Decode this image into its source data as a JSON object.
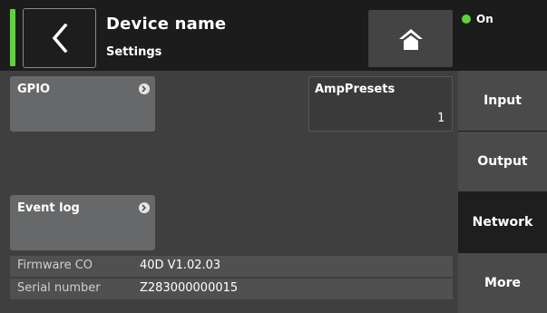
{
  "header": {
    "title": "Device name",
    "subtitle": "Settings",
    "power_status": "On",
    "status_color": "#5fd43a",
    "back_icon": "chevron-left-icon",
    "home_icon": "home-icon"
  },
  "main": {
    "tiles": [
      {
        "label": "GPIO",
        "icon": "arrow-right-circle-icon"
      },
      {
        "label": "Event log",
        "icon": "arrow-right-circle-icon"
      }
    ],
    "amp_presets": {
      "label": "AmpPresets",
      "value": "1"
    },
    "info": [
      {
        "key": "Firmware CO",
        "value": "40D V1.02.03"
      },
      {
        "key": "Serial number",
        "value": "Z283000000015"
      }
    ]
  },
  "side_nav": [
    {
      "label": "Input"
    },
    {
      "label": "Output"
    },
    {
      "label": "Network",
      "active": true
    },
    {
      "label": "More"
    }
  ]
}
